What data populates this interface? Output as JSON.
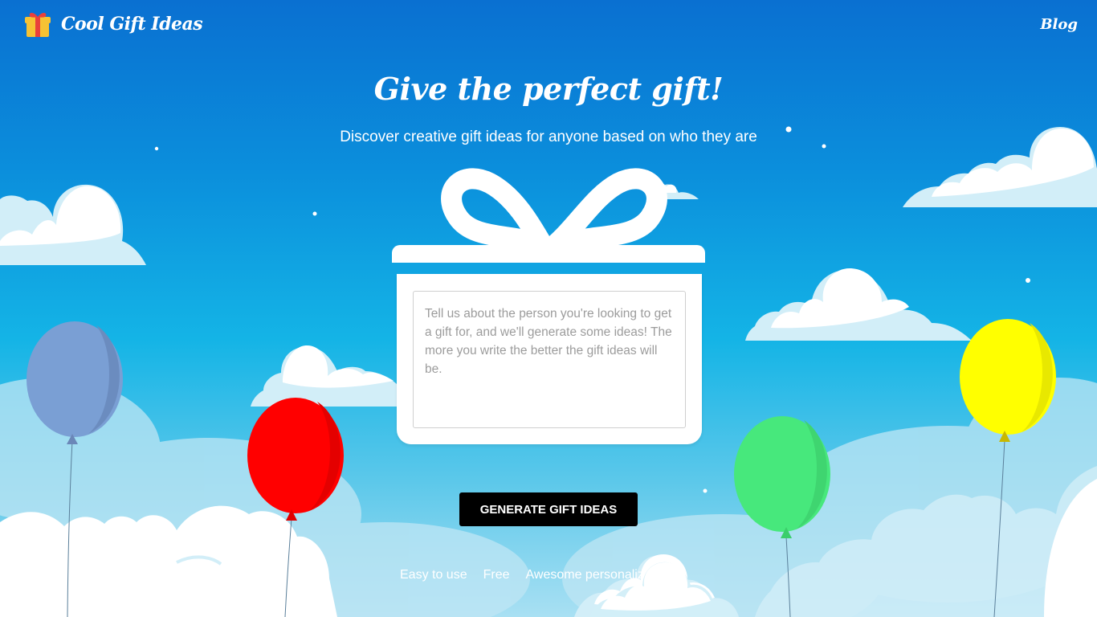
{
  "header": {
    "logo_text": "Cool Gift Ideas",
    "logo_icon": "gift-icon",
    "blog_label": "Blog"
  },
  "hero": {
    "title": "Give the perfect gift!",
    "subtitle": "Discover creative gift ideas for anyone based on who they are"
  },
  "form": {
    "description_placeholder": "Tell us about the person you're looking to get a gift for, and we'll generate some ideas! The more you write the better the gift ideas will be.",
    "description_value": "",
    "generate_label": "GENERATE GIFT IDEAS"
  },
  "features": [
    "Easy to use",
    "Free",
    "Awesome personalized"
  ],
  "colors": {
    "sky_top": "#0a70d1",
    "sky_bottom": "#a9e0f3",
    "button": "#000000",
    "balloon_purple": "#7a9fd4",
    "balloon_red": "#ff0000",
    "balloon_green": "#47e87c",
    "balloon_yellow": "#ffff00"
  }
}
